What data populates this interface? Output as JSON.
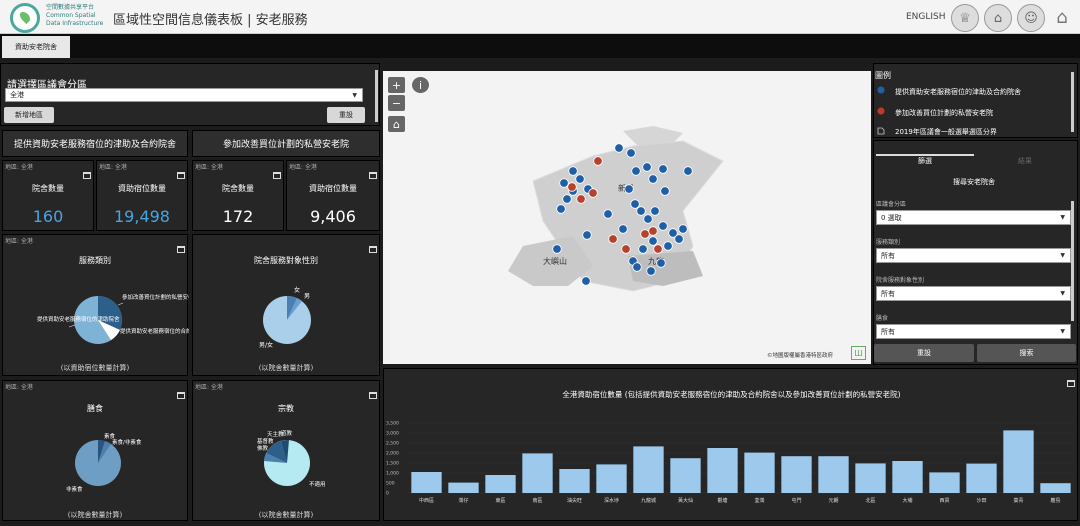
{
  "header": {
    "logo_line1": "空間數據共享平台",
    "logo_line2": "Common Spatial",
    "logo_line3": "Data Infrastructure",
    "title": "區域性空間信息儀表板 | 安老服務",
    "lang_label": "ENGLISH",
    "icons": [
      "trophy-icon",
      "house-icon",
      "person-icon",
      "home-icon"
    ]
  },
  "tabs": [
    {
      "label": "資助安老院舍",
      "active": true
    }
  ],
  "selector": {
    "title": "請選擇區議會分區",
    "value": "全港",
    "add_button": "新增地區",
    "reset_button": "重設"
  },
  "sections": {
    "left_header": "提供資助安老服務宿位的津助及合約院舍",
    "right_header": "參加改善買位計劃的私營安老院"
  },
  "area_label": "地區: 全港",
  "kpis": [
    {
      "label": "院舍數量",
      "value": "160",
      "color": "#4aa3df"
    },
    {
      "label": "資助宿位數量",
      "value": "19,498",
      "color": "#4aa3df"
    },
    {
      "label": "院舍數量",
      "value": "172",
      "color": "#ffffff"
    },
    {
      "label": "資助宿位數量",
      "value": "9,406",
      "color": "#ffffff"
    }
  ],
  "pies": [
    {
      "title": "服務類別",
      "footer": "(以資助宿位數量計算)",
      "labels": [
        "參加改善買位計劃的私營安老院",
        "提供資助安老服務宿位的津助院舍",
        "提供資助安老服務宿位的合約院舍"
      ]
    },
    {
      "title": "院舍服務對象性別",
      "footer": "(以院舍數量計算)",
      "labels": [
        "女",
        "男",
        "男/女"
      ]
    },
    {
      "title": "膳食",
      "footer": "(以院舍數量計算)",
      "labels": [
        "素食",
        "素食/非素食",
        "非素食"
      ]
    },
    {
      "title": "宗教",
      "footer": "(以院舍數量計算)",
      "labels": [
        "天主教",
        "基督教",
        "道教",
        "佛教",
        "不適用"
      ]
    }
  ],
  "map": {
    "labels": [
      "新界",
      "大嶼山",
      "九龍"
    ],
    "attribution": "©地圖版權屬香港特區政府",
    "info_symbol": "i"
  },
  "legend": {
    "title": "圖例",
    "items": [
      "提供資助安老服務宿位的津助及合約院舍",
      "參加改善買位計劃的私營安老院",
      "2019年區議會一般選舉選區分界"
    ]
  },
  "filter_panel": {
    "tabs": [
      "篩選",
      "結果"
    ],
    "subtitle": "搜尋安老院舍",
    "fields": [
      {
        "label": "區議會分區",
        "value": "0 選取"
      },
      {
        "label": "服務類別",
        "value": "所有"
      },
      {
        "label": "院舍服務對象性別",
        "value": "所有"
      },
      {
        "label": "膳食",
        "value": "所有"
      }
    ],
    "reset_button": "重設",
    "search_button": "搜索"
  },
  "chart_data": {
    "type": "bar",
    "title": "全港資助宿位數量 (包括提供資助安老服務宿位的津助及合約院舍以及參加改善買位計劃的私營安老院)",
    "categories": [
      "中西區",
      "灣仔",
      "東區",
      "南區",
      "油尖旺",
      "深水埗",
      "九龍城",
      "黃大仙",
      "觀塘",
      "荃灣",
      "屯門",
      "元朗",
      "北區",
      "大埔",
      "西貢",
      "沙田",
      "葵青",
      "離島"
    ],
    "values": [
      1050,
      520,
      900,
      1980,
      1200,
      1430,
      2330,
      1740,
      2250,
      2020,
      1840,
      1840,
      1480,
      1600,
      1030,
      1470,
      3130,
      490
    ],
    "ylim": [
      0,
      3500
    ],
    "yticks": [
      "0",
      "500",
      "1,000",
      "1,500",
      "2,000",
      "2,500",
      "3,000",
      "3,500"
    ],
    "color": "#9cc9ec"
  }
}
